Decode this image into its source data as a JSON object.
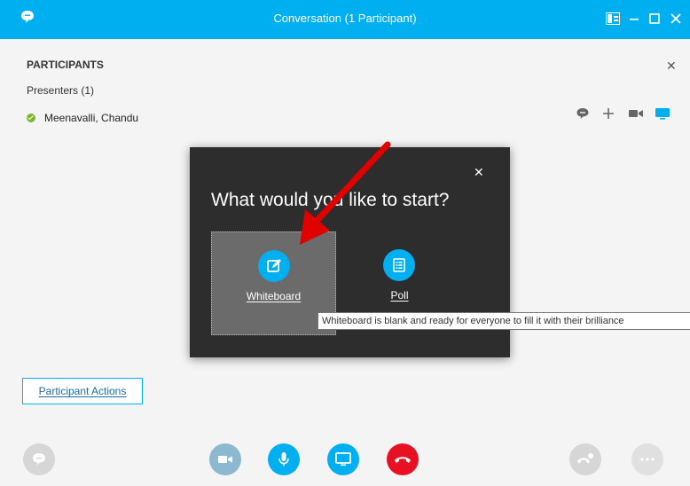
{
  "titlebar": {
    "title": "Conversation (1 Participant)"
  },
  "participants_panel": {
    "header": "PARTICIPANTS",
    "presenters_label": "Presenters (1)",
    "participant_name": "Meenavalli, Chandu"
  },
  "dialog": {
    "title": "What would you like to start?",
    "options": [
      {
        "label": "Whiteboard",
        "icon": "whiteboard-icon"
      },
      {
        "label": "Poll",
        "icon": "poll-icon"
      }
    ],
    "tooltip": "Whiteboard is blank and ready for everyone to fill it with their brilliance"
  },
  "participant_actions_label": "Participant Actions",
  "colors": {
    "accent": "#00aff0",
    "titlebar": "#00aff0",
    "hangup": "#e81123",
    "presence_available": "#7cb82f",
    "dialog_bg": "#2d2d2d",
    "annotation_arrow": "#e00000"
  },
  "toolbar_icons": [
    "chat-icon",
    "video-icon",
    "mic-icon",
    "present-screen-icon",
    "hangup-icon",
    "call-controls-icon",
    "more-options-icon"
  ]
}
